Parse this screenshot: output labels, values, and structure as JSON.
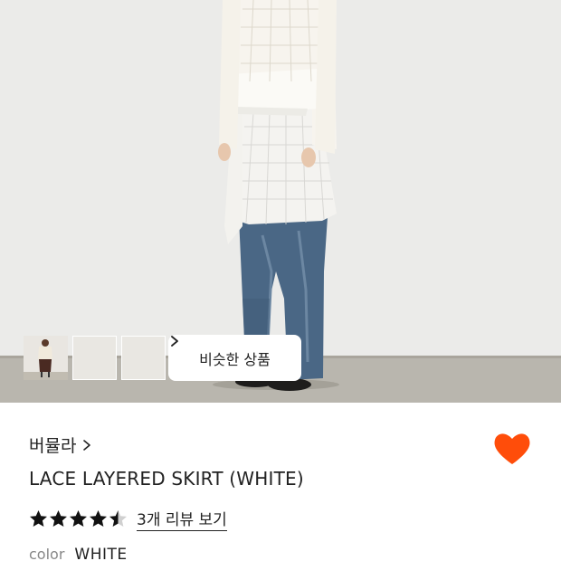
{
  "gallery": {
    "similar_button_label": "비슷한 상품",
    "thumbnails": [
      {
        "alt": "model-photo-1"
      },
      {
        "alt": "model-photo-2"
      },
      {
        "alt": "model-photo-3"
      }
    ]
  },
  "product": {
    "brand": "버뮬라",
    "title": "LACE LAYERED SKIRT (WHITE)",
    "rating": 4.5,
    "review_link": "3개 리뷰 보기",
    "color_label": "color",
    "color_value": "WHITE",
    "wishlisted": true
  },
  "colors": {
    "heart": "#ff4d0a",
    "text": "#222222",
    "muted": "#888888"
  },
  "icons": {
    "brand_chevron": "chevron-right-icon",
    "similar_chevron": "chevron-right-icon",
    "wishlist": "heart-icon",
    "star": "star-icon"
  }
}
